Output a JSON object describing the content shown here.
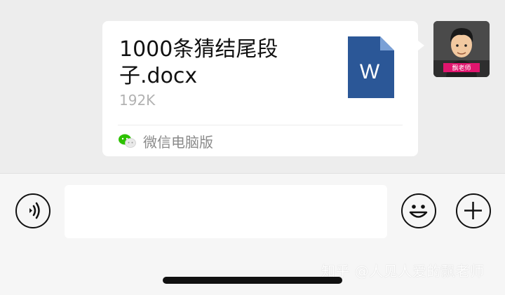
{
  "message": {
    "file_name": "1000条猜结尾段子.docx",
    "file_size": "192K",
    "file_type_letter": "W",
    "source_label": "微信电脑版",
    "source_icon": "wechat-pc-icon"
  },
  "avatar": {
    "badge_text": "飘老师"
  },
  "input_bar": {
    "voice_icon": "voice-icon",
    "text_value": "",
    "emoji_icon": "emoji-icon",
    "plus_icon": "plus-icon"
  },
  "watermark": "知乎 @人见人爱的飘老师",
  "colors": {
    "chat_background": "#ededed",
    "bubble": "#ffffff",
    "word_blue": "#2b5797",
    "wechat_green": "#2dc100"
  }
}
